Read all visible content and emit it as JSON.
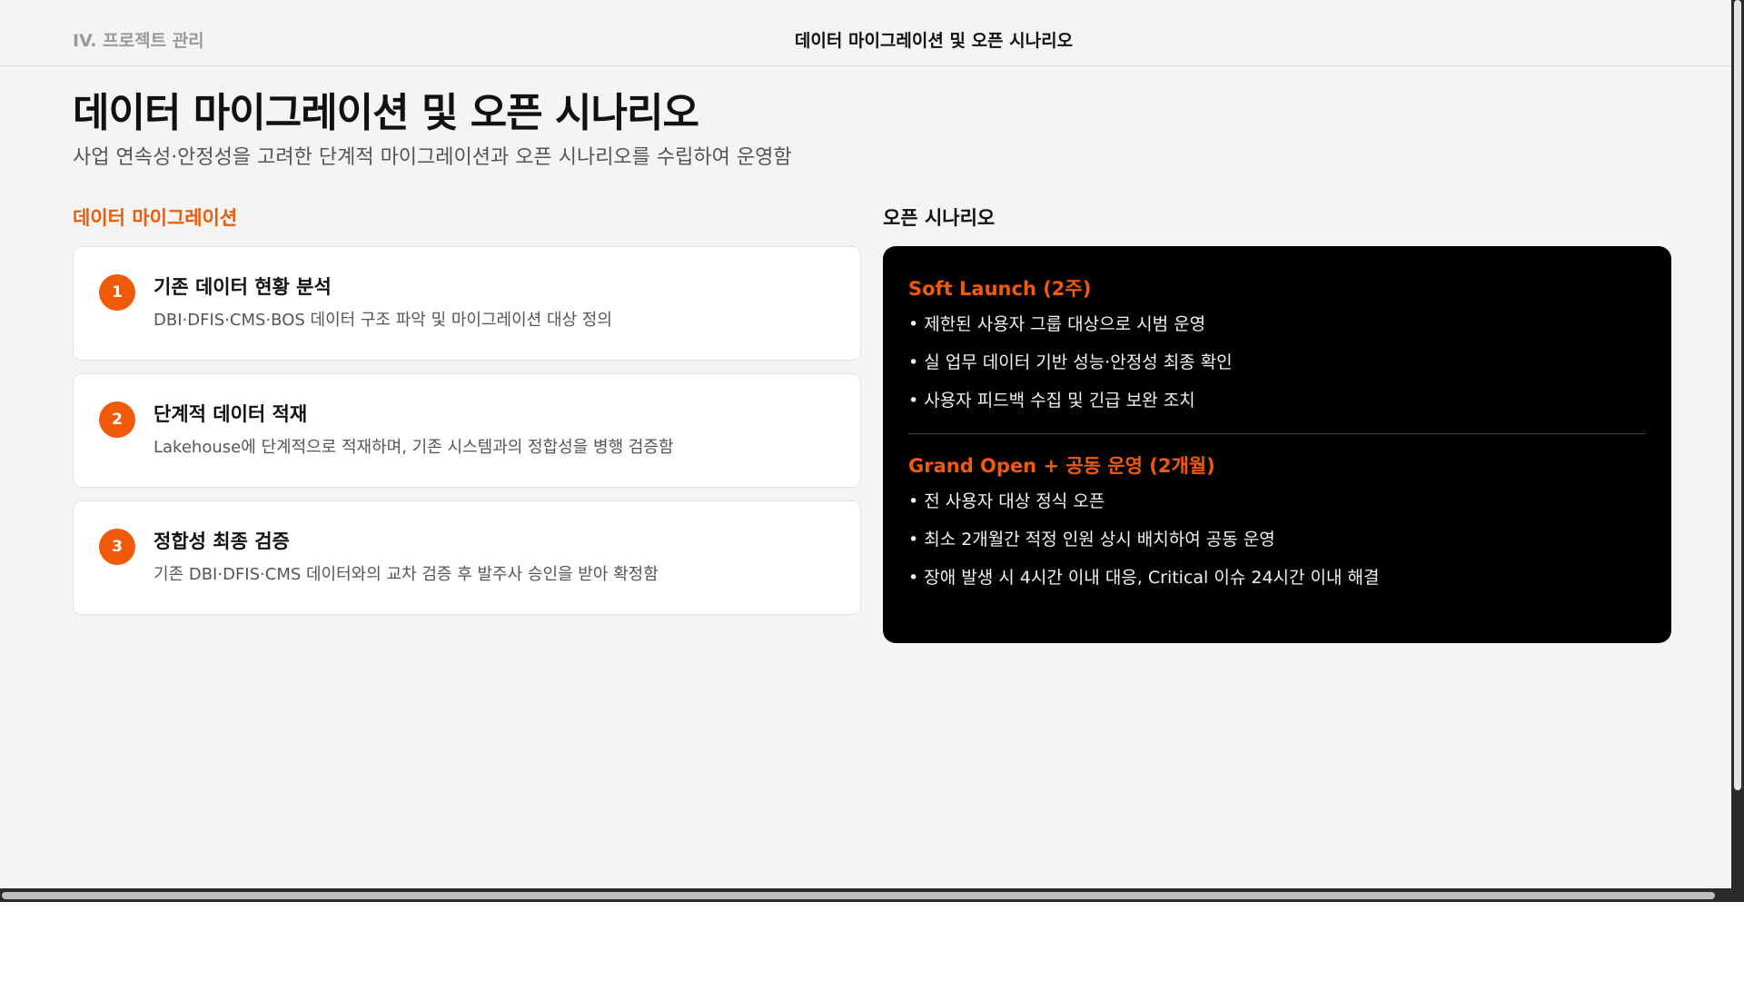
{
  "header": {
    "section_label": "IV. 프로젝트 관리",
    "title": "데이터 마이그레이션 및 오픈 시나리오"
  },
  "page": {
    "title": "데이터 마이그레이션 및 오픈 시나리오",
    "subtitle": "사업 연속성·안정성을 고려한 단계적 마이그레이션과 오픈 시나리오를 수립하여 운영함"
  },
  "migration": {
    "heading": "데이터 마이그레이션",
    "steps": [
      {
        "num": "1",
        "title": "기존 데이터 현황 분석",
        "desc": "DBI·DFIS·CMS·BOS 데이터 구조 파악 및 마이그레이션 대상 정의"
      },
      {
        "num": "2",
        "title": "단계적 데이터 적재",
        "desc": "Lakehouse에 단계적으로 적재하며, 기존 시스템과의 정합성을 병행 검증함"
      },
      {
        "num": "3",
        "title": "정합성 최종 검증",
        "desc": "기존 DBI·DFIS·CMS 데이터와의 교차 검증 후 발주사 승인을 받아 확정함"
      }
    ]
  },
  "open_scenario": {
    "heading": "오픈 시나리오",
    "phases": [
      {
        "title": "Soft Launch (2주)",
        "items": [
          "제한된 사용자 그룹 대상으로 시범 운영",
          "실 업무 데이터 기반 성능·안정성 최종 확인",
          "사용자 피드백 수집 및 긴급 보완 조치"
        ]
      },
      {
        "title": "Grand Open + 공동 운영 (2개월)",
        "items": [
          "전 사용자 대상 정식 오픈",
          "최소 2개월간 적정 인원 상시 배치하여 공동 운영",
          "장애 발생 시 4시간 이내 대응, Critical 이슈 24시간 이내 해결"
        ]
      }
    ]
  },
  "colors": {
    "accent": "#f05a0a",
    "background": "#f4f4f4",
    "panel_dark": "#000000"
  }
}
